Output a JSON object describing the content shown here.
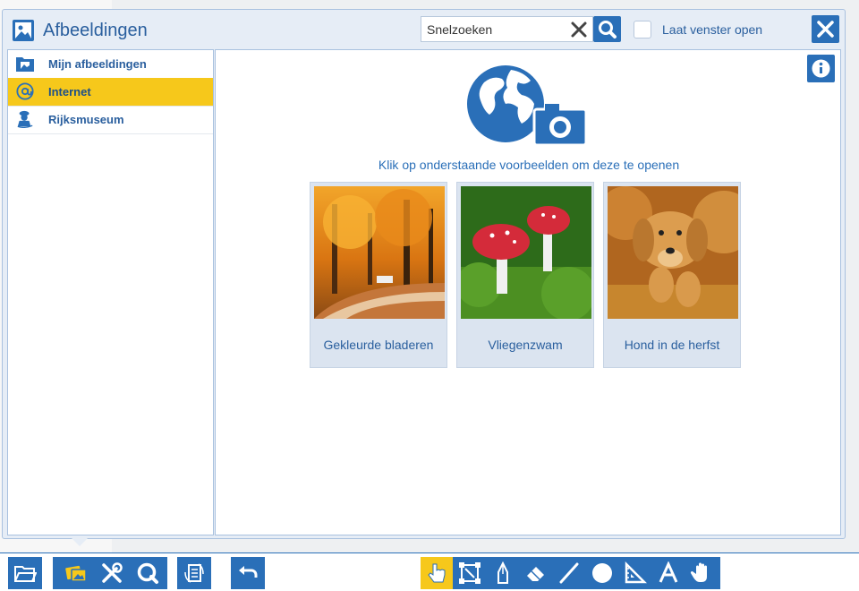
{
  "dialog": {
    "title": "Afbeeldingen",
    "search_placeholder": "Snelzoeken",
    "keep_open_label": "Laat venster open"
  },
  "sidebar": {
    "items": [
      {
        "label": "Mijn afbeeldingen",
        "icon": "folder-image-icon",
        "active": false
      },
      {
        "label": "Internet",
        "icon": "at-sign-icon",
        "active": true
      },
      {
        "label": "Rijksmuseum",
        "icon": "museum-icon",
        "active": false
      }
    ]
  },
  "main": {
    "hint": "Klik op onderstaande voorbeelden om deze te openen",
    "examples": [
      {
        "caption": "Gekleurde bladeren",
        "image": "autumn-park-path"
      },
      {
        "caption": "Vliegenzwam",
        "image": "fly-agaric-mushrooms"
      },
      {
        "caption": "Hond in de herfst",
        "image": "dog-running-autumn"
      }
    ]
  },
  "toolbar": {
    "groups": [
      {
        "buttons": [
          "open-folder-icon"
        ]
      },
      {
        "buttons": [
          "photos-icon",
          "tools-icon",
          "zoom-icon"
        ]
      },
      {
        "buttons": [
          "page-rotate-icon"
        ]
      },
      {
        "buttons": [
          "undo-icon"
        ]
      },
      {
        "buttons": [
          "pointer-hand-icon",
          "select-rectangle-icon",
          "pen-icon",
          "eraser-icon",
          "line-icon",
          "circle-icon",
          "ruler-triangle-icon",
          "text-icon",
          "pan-hand-icon"
        ]
      }
    ],
    "selected_tool": "pointer-hand-icon"
  },
  "colors": {
    "accent_blue": "#2a6fb8",
    "highlight_yellow": "#f6c81b",
    "panel_bg": "#e6edf6"
  }
}
